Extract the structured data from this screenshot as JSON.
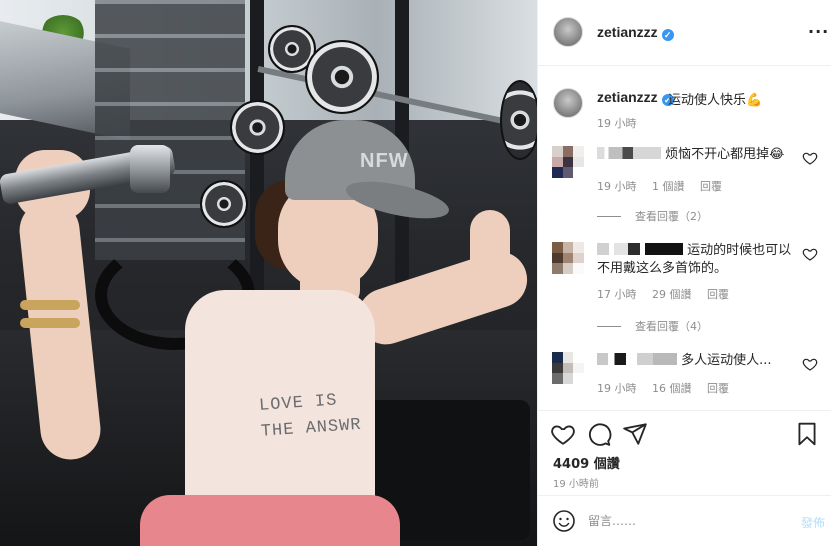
{
  "post": {
    "username": "zetianzzz",
    "verified": true,
    "more_label": "···",
    "photo": {
      "cap_text": "NFW",
      "tank_print": "LOVE IS THE ANSWR"
    }
  },
  "caption": {
    "username": "zetianzzz",
    "text": "运动使人快乐💪",
    "time": "19 小時"
  },
  "comments": [
    {
      "text": "烦恼不开心都甩掉😂",
      "time": "19 小時",
      "likes": "1 個讚",
      "reply_label": "回覆",
      "view_replies": "查看回覆（2）"
    },
    {
      "text": "运动的时候也可以不用戴这么多首饰的。",
      "time": "17 小時",
      "likes": "29 個讚",
      "reply_label": "回覆",
      "view_replies": "查看回覆（4）"
    },
    {
      "text": "多人运动使人...",
      "time": "19 小時",
      "likes": "16 個讚",
      "reply_label": "回覆"
    }
  ],
  "actions": {
    "like_icon": "heart-icon",
    "comment_icon": "comment-icon",
    "share_icon": "share-icon",
    "save_icon": "bookmark-icon"
  },
  "stats": {
    "likes": "4409 個讚",
    "posted": "19 小時前"
  },
  "comment_box": {
    "placeholder": "留言……",
    "post_label": "發佈"
  },
  "colors": {
    "verified": "#3897f0",
    "muted": "#8e8e8e",
    "post_disabled": "#b2dffc",
    "text": "#262626",
    "border": "#efefef"
  }
}
